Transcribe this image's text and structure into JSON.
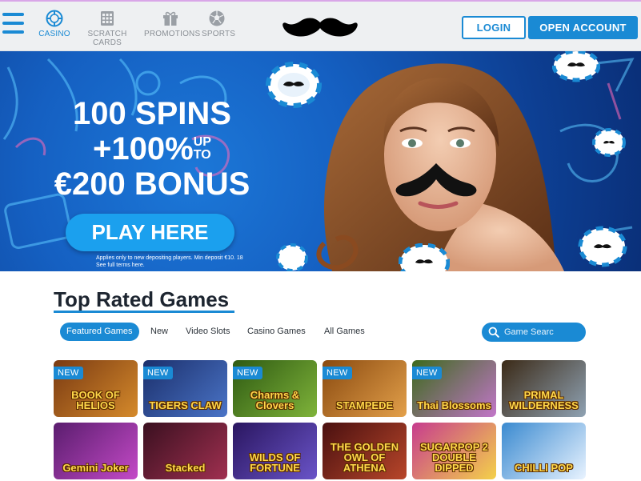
{
  "nav": {
    "items": [
      {
        "label": "CASINO",
        "icon": "casino-chip-icon",
        "active": true
      },
      {
        "label": "SCRATCH CARDS",
        "icon": "scratch-card-icon",
        "active": false
      },
      {
        "label": "PROMOTIONS",
        "icon": "gift-icon",
        "active": false
      },
      {
        "label": "SPORTS",
        "icon": "football-icon",
        "active": false
      }
    ],
    "login_label": "LOGIN",
    "open_account_label": "OPEN ACCOUNT"
  },
  "hero": {
    "line1": "100 SPINS",
    "line2": "+100%",
    "up": "UP",
    "to": "TO",
    "line3": "€200 BONUS",
    "cta": "PLAY HERE",
    "terms_line1": "Applies only to new depositing players. Min deposit €10. 18",
    "terms_line2": "See full terms here."
  },
  "games": {
    "title": "Top Rated Games",
    "tabs": [
      "Featured Games",
      "New",
      "Video Slots",
      "Casino Games",
      "All Games"
    ],
    "active_tab": "Featured Games",
    "search_placeholder": "Game Searc",
    "tiles": [
      {
        "name": "BOOK OF HELIOS",
        "new": true,
        "colors": [
          "#7a3a12",
          "#d58a2b"
        ]
      },
      {
        "name": "TIGERS CLAW",
        "new": true,
        "colors": [
          "#1b2f6b",
          "#4a74c7"
        ]
      },
      {
        "name": "Charms & Clovers",
        "new": true,
        "colors": [
          "#2e5a12",
          "#7fb33a"
        ]
      },
      {
        "name": "STAMPEDE",
        "new": true,
        "colors": [
          "#8a4a10",
          "#e3a04a"
        ]
      },
      {
        "name": "Thai Blossoms",
        "new": true,
        "colors": [
          "#3c6a1c",
          "#c276c9"
        ]
      },
      {
        "name": "PRIMAL WILDERNESS",
        "new": false,
        "colors": [
          "#3b2a17",
          "#8fa2b3"
        ]
      },
      {
        "name": "Gemini Joker",
        "new": false,
        "colors": [
          "#5a1d6e",
          "#c44ac7"
        ]
      },
      {
        "name": "Stacked",
        "new": false,
        "colors": [
          "#3a1020",
          "#a03050"
        ]
      },
      {
        "name": "WILDS OF FORTUNE",
        "new": false,
        "colors": [
          "#2a1660",
          "#6a54c8"
        ]
      },
      {
        "name": "THE GOLDEN OWL OF ATHENA",
        "new": false,
        "colors": [
          "#4a1010",
          "#b8462a"
        ]
      },
      {
        "name": "SUGARPOP 2 DOUBLE DIPPED",
        "new": false,
        "colors": [
          "#c73c8e",
          "#f4d14a"
        ]
      },
      {
        "name": "CHILLI POP",
        "new": false,
        "colors": [
          "#3a8ad0",
          "#e9f3ff"
        ]
      }
    ],
    "new_badge": "NEW"
  },
  "colors": {
    "accent": "#1a8ad4",
    "hero_bg": "#1560c2"
  }
}
